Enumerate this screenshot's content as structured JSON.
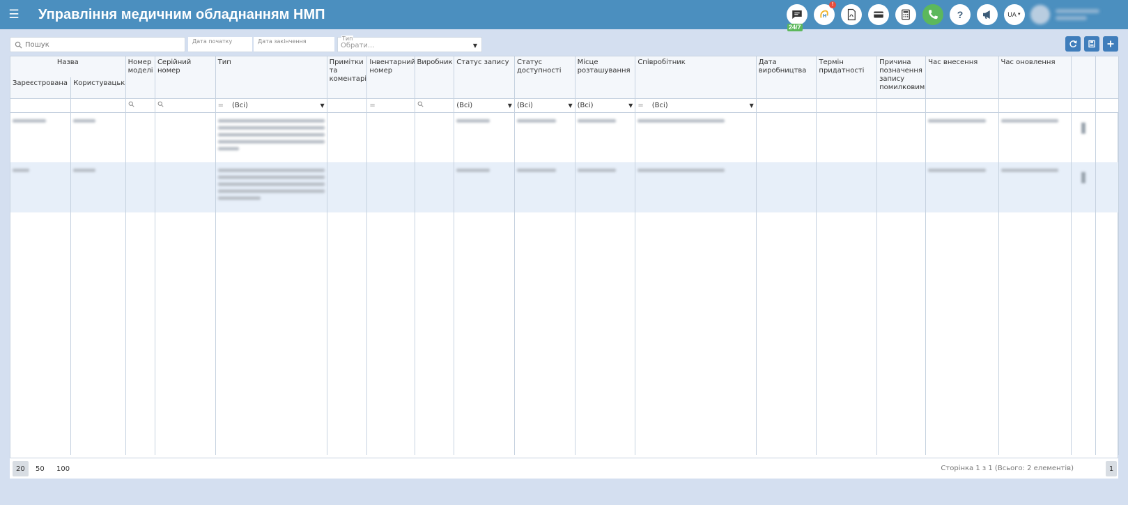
{
  "header": {
    "title": "Управління медичним обладнанням НМП",
    "badge_247": "24/7",
    "notif_count": "!",
    "lang": "UA"
  },
  "filters": {
    "search_placeholder": "Пошук",
    "date_start_label": "Дата початку",
    "date_end_label": "Дата закінчення",
    "type_label": "Тип",
    "type_placeholder": "Обрати..."
  },
  "grid": {
    "group_name": "Назва",
    "cols": {
      "registered": "Зареєстрована",
      "custom": "Користувацька",
      "model_number": "Номер моделі",
      "serial_number": "Серійний номер",
      "type": "Тип",
      "notes": "Примітки та коментарі",
      "inventory_number": "Інвентарний номер",
      "manufacturer": "Виробник",
      "record_status": "Статус запису",
      "availability_status": "Статус доступності",
      "location": "Місце розташування",
      "employee": "Співробітник",
      "production_date": "Дата виробництва",
      "expiry": "Термін придатності",
      "error_reason": "Причина позначення запису помилковим",
      "created_time": "Час внесення",
      "updated_time": "Час оновлення"
    },
    "filter_all": "(Всі)",
    "filter_eq": "="
  },
  "pager": {
    "sizes": [
      "20",
      "50",
      "100"
    ],
    "info": "Сторінка 1 з 1 (Всього: 2 елементів)",
    "current_page": "1"
  }
}
